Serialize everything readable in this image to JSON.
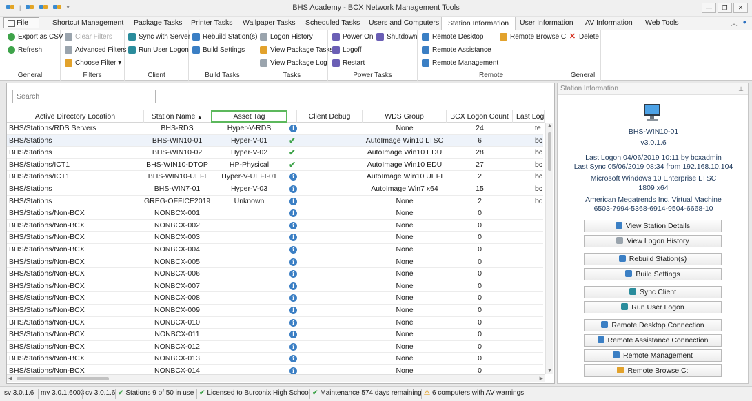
{
  "window": {
    "title": "BHS Academy - BCX Network Management Tools",
    "buttons": [
      "—",
      "❐",
      "✕"
    ]
  },
  "tabs": {
    "file": "File",
    "items": [
      "Shortcut Management",
      "Package Tasks",
      "Printer Tasks",
      "Wallpaper Tasks",
      "Scheduled Tasks",
      "Users and Computers",
      "Station Information",
      "User Information",
      "AV Information",
      "Web Tools"
    ],
    "active": "Station Information"
  },
  "ribbon": {
    "general1": {
      "label": "General",
      "export_csv": "Export as CSV",
      "refresh": "Refresh"
    },
    "filters": {
      "label": "Filters",
      "clear": "Clear Filters",
      "advanced": "Advanced Filters",
      "choose": "Choose Filter ▾"
    },
    "client": {
      "label": "Client",
      "sync": "Sync with Server",
      "run_logon": "Run User Logon"
    },
    "build": {
      "label": "Build Tasks",
      "rebuild": "Rebuild Station(s)",
      "settings": "Build Settings"
    },
    "tasks": {
      "label": "Tasks",
      "logon_history": "Logon History",
      "view_pkg_tasks": "View Package Tasks",
      "view_pkg_log": "View Package Log"
    },
    "power": {
      "label": "Power Tasks",
      "power_on": "Power On",
      "shutdown": "Shutdown",
      "logoff": "Logoff",
      "restart": "Restart"
    },
    "remote": {
      "label": "Remote",
      "desktop": "Remote Desktop",
      "assistance": "Remote Assistance",
      "management": "Remote Management",
      "browse": "Remote Browse C:"
    },
    "general2": {
      "label": "General",
      "delete": "Delete"
    }
  },
  "grid": {
    "search_placeholder": "Search",
    "columns": [
      "Active Directory Location",
      "Station Name",
      "Asset Tag",
      "",
      "Client Debug",
      "WDS Group",
      "BCX Logon Count",
      "Last Logo"
    ],
    "rows": [
      [
        "BHS/Stations/RDS Servers",
        "BHS-RDS",
        "Hyper-V-RDS",
        "info",
        "",
        "None",
        "24",
        "te"
      ],
      [
        "BHS/Stations",
        "BHS-WIN10-01",
        "Hyper-V-01",
        "ok",
        "",
        "AutoImage Win10 LTSC",
        "6",
        "bc"
      ],
      [
        "BHS/Stations",
        "BHS-WIN10-02",
        "Hyper-V-02",
        "ok",
        "",
        "AutoImage Win10 EDU",
        "28",
        "bc"
      ],
      [
        "BHS/Stations/ICT1",
        "BHS-WIN10-DTOP",
        "HP-Physical",
        "ok",
        "",
        "AutoImage Win10 EDU",
        "27",
        "bc"
      ],
      [
        "BHS/Stations/ICT1",
        "BHS-WIN10-UEFI",
        "Hyper-V-UEFI-01",
        "info",
        "",
        "AutoImage Win10 UEFI",
        "2",
        "bc"
      ],
      [
        "BHS/Stations",
        "BHS-WIN7-01",
        "Hyper-V-03",
        "info",
        "",
        "AutoImage Win7 x64",
        "15",
        "bc"
      ],
      [
        "BHS/Stations",
        "GREG-OFFICE2019",
        "Unknown",
        "info",
        "",
        "None",
        "2",
        "bc"
      ],
      [
        "BHS/Stations/Non-BCX",
        "NONBCX-001",
        "",
        "info",
        "",
        "None",
        "0",
        ""
      ],
      [
        "BHS/Stations/Non-BCX",
        "NONBCX-002",
        "",
        "info",
        "",
        "None",
        "0",
        ""
      ],
      [
        "BHS/Stations/Non-BCX",
        "NONBCX-003",
        "",
        "info",
        "",
        "None",
        "0",
        ""
      ],
      [
        "BHS/Stations/Non-BCX",
        "NONBCX-004",
        "",
        "info",
        "",
        "None",
        "0",
        ""
      ],
      [
        "BHS/Stations/Non-BCX",
        "NONBCX-005",
        "",
        "info",
        "",
        "None",
        "0",
        ""
      ],
      [
        "BHS/Stations/Non-BCX",
        "NONBCX-006",
        "",
        "info",
        "",
        "None",
        "0",
        ""
      ],
      [
        "BHS/Stations/Non-BCX",
        "NONBCX-007",
        "",
        "info",
        "",
        "None",
        "0",
        ""
      ],
      [
        "BHS/Stations/Non-BCX",
        "NONBCX-008",
        "",
        "info",
        "",
        "None",
        "0",
        ""
      ],
      [
        "BHS/Stations/Non-BCX",
        "NONBCX-009",
        "",
        "info",
        "",
        "None",
        "0",
        ""
      ],
      [
        "BHS/Stations/Non-BCX",
        "NONBCX-010",
        "",
        "info",
        "",
        "None",
        "0",
        ""
      ],
      [
        "BHS/Stations/Non-BCX",
        "NONBCX-011",
        "",
        "info",
        "",
        "None",
        "0",
        ""
      ],
      [
        "BHS/Stations/Non-BCX",
        "NONBCX-012",
        "",
        "info",
        "",
        "None",
        "0",
        ""
      ],
      [
        "BHS/Stations/Non-BCX",
        "NONBCX-013",
        "",
        "info",
        "",
        "None",
        "0",
        ""
      ],
      [
        "BHS/Stations/Non-BCX",
        "NONBCX-014",
        "",
        "info",
        "",
        "None",
        "0",
        ""
      ]
    ],
    "selected_row": 1
  },
  "info_panel": {
    "header": "Station Information",
    "station": "BHS-WIN10-01",
    "version": "v3.0.1.6",
    "last_logon": "Last Logon 04/06/2019 10:11 by bcxadmin",
    "last_sync": "Last Sync 05/06/2019 08:34 from 192.168.10.104",
    "os": "Microsoft Windows 10 Enterprise LTSC",
    "os_build": "1809 x64",
    "hardware": "American Megatrends Inc. Virtual Machine",
    "serial": "6503-7994-5368-6914-9504-6668-10",
    "buttons": [
      "View Station Details",
      "View Logon History",
      "Rebuild Station(s)",
      "Build Settings",
      "Sync Client",
      "Run User Logon",
      "Remote Desktop Connection",
      "Remote Assistance Connection",
      "Remote Management",
      "Remote Browse C:"
    ]
  },
  "statusbar": {
    "sv": "sv 3.0.1.6",
    "mv": "mv 3.0.1.6003",
    "cv": "cv 3.0.1.6",
    "stations": "Stations 9 of 50 in use",
    "license": "Licensed to Burconix High School",
    "maintenance": "Maintenance 574 days remaining",
    "av": "6 computers with AV warnings"
  },
  "colors": {
    "accent_green": "#5cb85c",
    "info_blue": "#3b7fc4",
    "ok_green": "#3ea34a",
    "warn_orange": "#e2a22c"
  }
}
